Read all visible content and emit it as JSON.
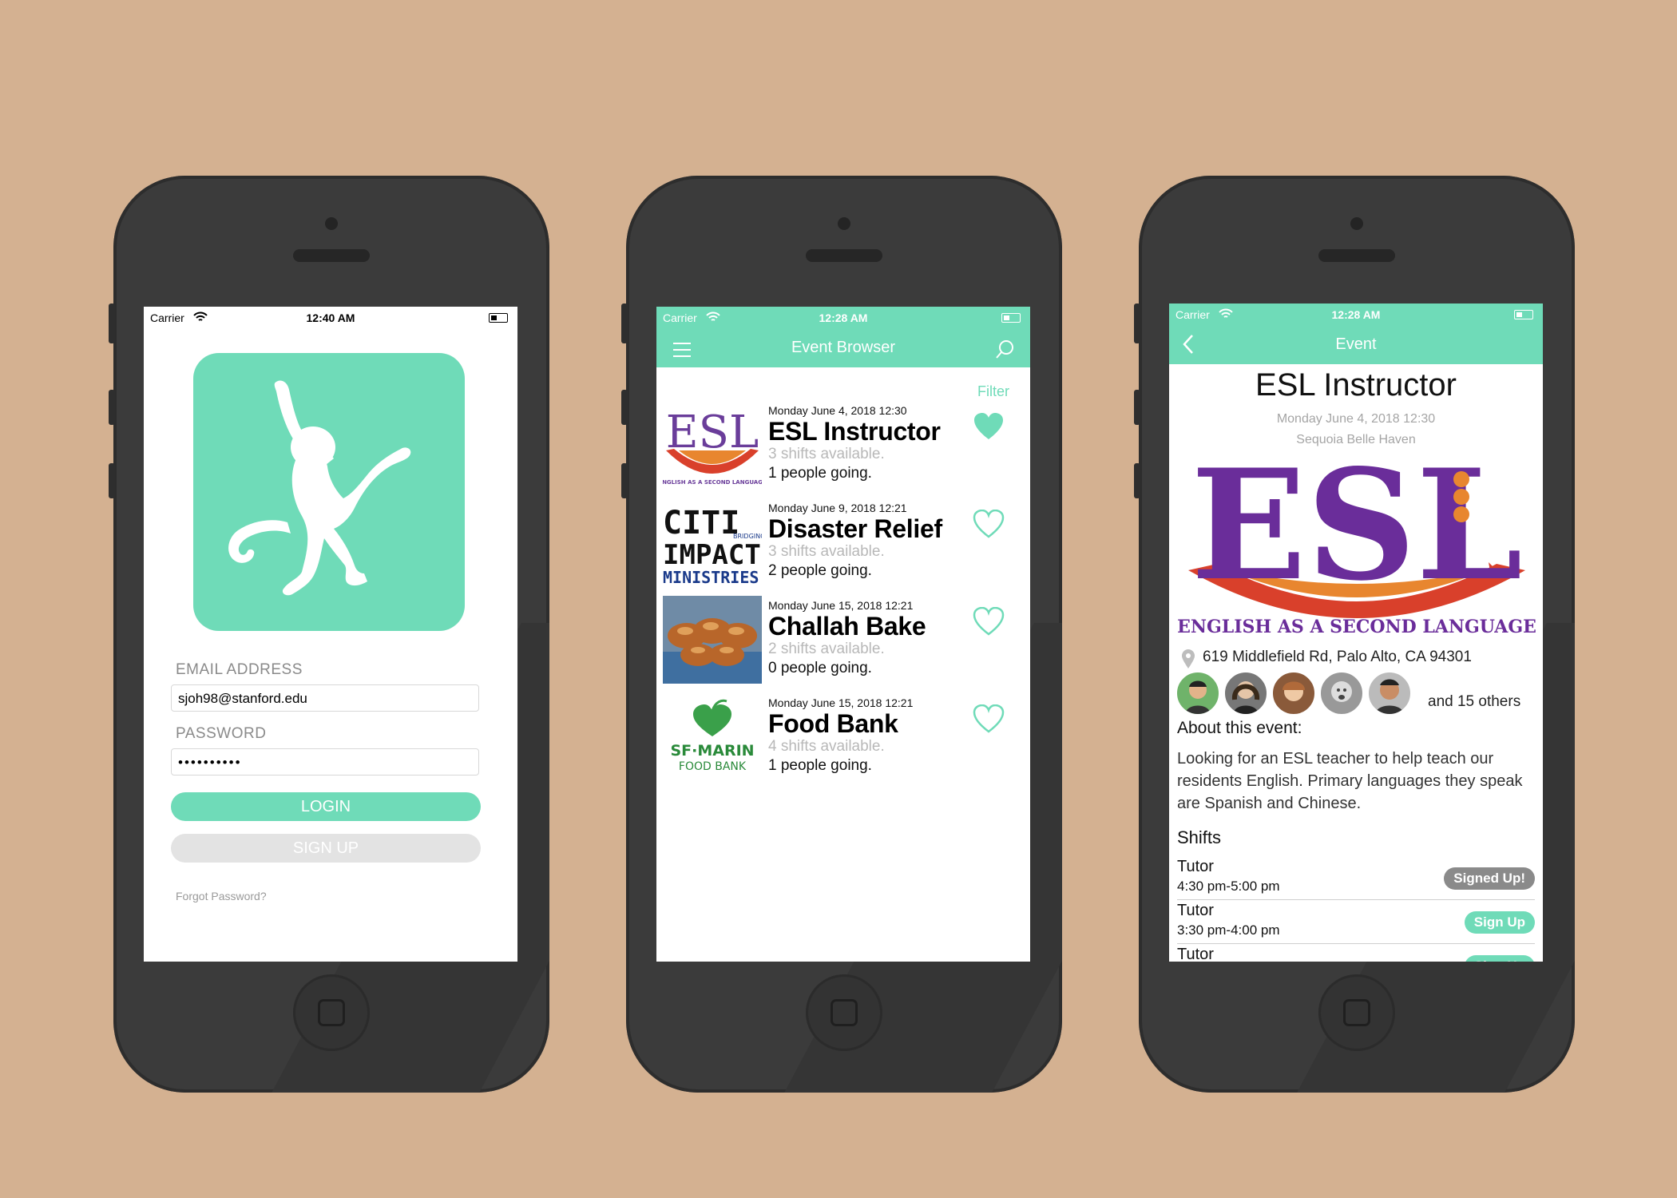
{
  "colors": {
    "background": "#d4b191",
    "accent": "#6fdbb8",
    "phone": "#3b3b3b",
    "signed_badge": "#8a8a8a"
  },
  "login": {
    "status": {
      "carrier": "Carrier",
      "time": "12:40 AM"
    },
    "email_label": "EMAIL ADDRESS",
    "email_value": "sjoh98@stanford.edu",
    "password_label": "PASSWORD",
    "password_value": "••••••••••",
    "login_button": "LOGIN",
    "signup_button": "SIGN UP",
    "forgot_link": "Forgot Password?"
  },
  "browser": {
    "status": {
      "carrier": "Carrier",
      "time": "12:28 AM"
    },
    "title": "Event Browser",
    "menu_icon": "hamburger-icon",
    "search_icon": "search-icon",
    "filter": "Filter",
    "events": [
      {
        "date": "Monday June 4, 2018 12:30",
        "name": "ESL Instructor",
        "shifts": "3 shifts available.",
        "going": "1 people going.",
        "favorited": true
      },
      {
        "date": "Monday June 9, 2018 12:21",
        "name": "Disaster Relief",
        "shifts": "3 shifts available.",
        "going": "2 people going.",
        "favorited": false
      },
      {
        "date": "Monday June 15, 2018 12:21",
        "name": "Challah Bake",
        "shifts": "2 shifts available.",
        "going": "0 people going.",
        "favorited": false
      },
      {
        "date": "Monday June 15, 2018 12:21",
        "name": "Food Bank",
        "shifts": "4 shifts available.",
        "going": "1 people going.",
        "favorited": false
      }
    ],
    "logos": {
      "esl": "ESL",
      "esl_caption": "ENGLISH AS A SECOND LANGUAGE",
      "citi_top": "CITI",
      "citi_small": "BRIDGING",
      "citi_mid": "IMPACT",
      "citi_bot": "MINISTRIES",
      "sf1": "SF·MARIN",
      "sf2": "FOOD BANK"
    }
  },
  "detail": {
    "status": {
      "carrier": "Carrier",
      "time": "12:28 AM"
    },
    "back_icon": "chevron-left-icon",
    "nav_title": "Event",
    "title": "ESL Instructor",
    "date": "Monday June 4, 2018 12:30",
    "location_name": "Sequoia Belle Haven",
    "logo_text": "ESL",
    "logo_caption": "ENGLISH AS A SECOND LANGUAGE",
    "address": "619 Middlefield Rd, Palo Alto, CA 94301",
    "attendees_more": "and 15 others",
    "about_heading": "About this event:",
    "description": "Looking for an ESL teacher to help teach our residents English. Primary languages they speak are Spanish and Chinese.",
    "shifts_heading": "Shifts",
    "shifts": [
      {
        "role": "Tutor",
        "time": "4:30 pm-5:00 pm",
        "action": "Signed Up!"
      },
      {
        "role": "Tutor",
        "time": "3:30 pm-4:00 pm",
        "action": "Sign Up"
      },
      {
        "role": "Tutor",
        "time": "",
        "action": "Sign Up"
      }
    ]
  }
}
